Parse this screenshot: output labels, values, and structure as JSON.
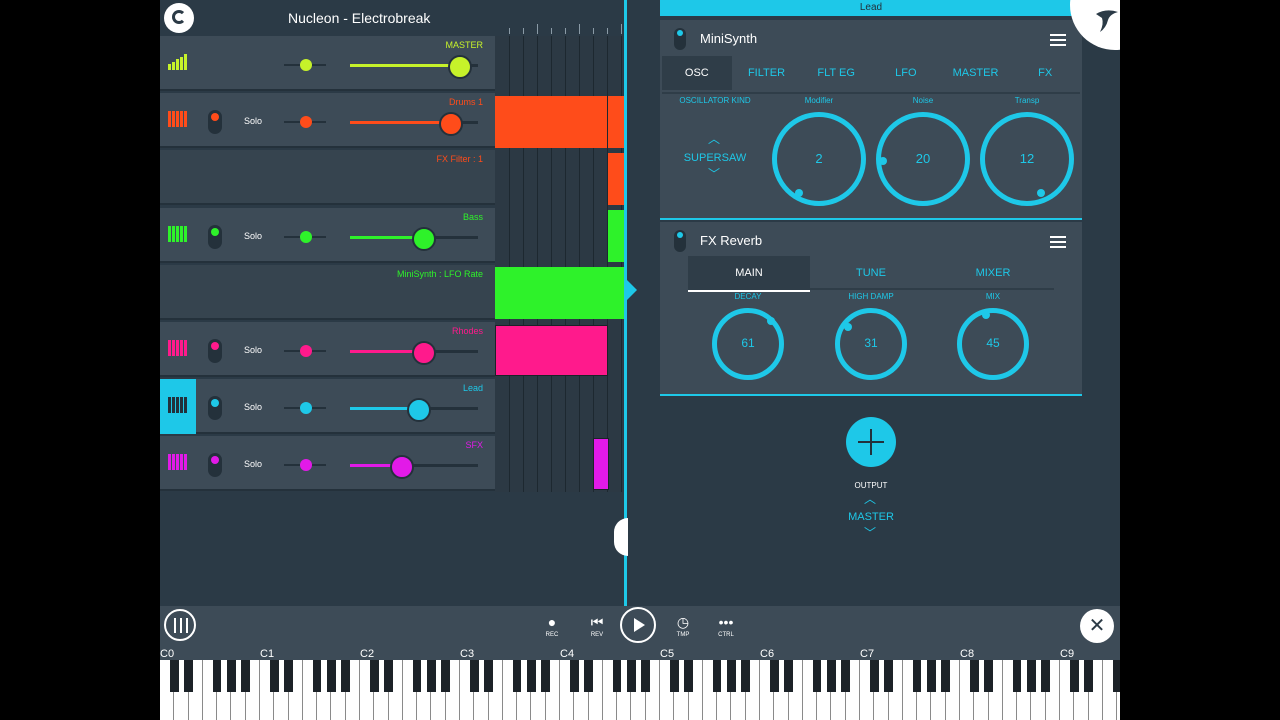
{
  "project": {
    "title": "Nucleon - Electrobreak"
  },
  "tracks": [
    {
      "name": "MASTER",
      "color": "#c6f22a",
      "icon": "level-meter-icon",
      "solo": "",
      "volume": 0.84
    },
    {
      "name": "Drums 1",
      "color": "#ff4c1a",
      "icon": "drum-pad-icon",
      "solo": "Solo",
      "volume": 0.77
    },
    {
      "name": "FX Filter : 1",
      "color": "#ff4c1a",
      "icon": "",
      "solo": "",
      "volume": null
    },
    {
      "name": "Bass",
      "color": "#2ef22a",
      "icon": "keyboard-icon",
      "solo": "Solo",
      "volume": 0.56
    },
    {
      "name": "MiniSynth : LFO Rate",
      "color": "#2ef22a",
      "icon": "",
      "solo": "",
      "volume": null
    },
    {
      "name": "Rhodes",
      "color": "#ff1a8c",
      "icon": "keyboard-icon",
      "solo": "Solo",
      "volume": 0.56
    },
    {
      "name": "Lead",
      "color": "#1ec8e8",
      "icon": "keyboard-icon",
      "solo": "Solo",
      "volume": 0.52
    },
    {
      "name": "SFX",
      "color": "#e21ae8",
      "icon": "keyboard-icon",
      "solo": "Solo",
      "volume": 0.39
    }
  ],
  "lead_bar": {
    "label": "Lead"
  },
  "minisynth": {
    "title": "MiniSynth",
    "tabs": [
      "OSC",
      "FILTER",
      "FLT EG",
      "LFO",
      "MASTER",
      "FX"
    ],
    "osc_kind_label": "OSCILLATOR KIND",
    "osc_kind_value": "SUPERSAW",
    "knobs": [
      {
        "label": "Modifier",
        "value": "2"
      },
      {
        "label": "Noise",
        "value": "20"
      },
      {
        "label": "Transp",
        "value": "12"
      }
    ]
  },
  "reverb": {
    "title": "FX Reverb",
    "tabs": [
      "MAIN",
      "TUNE",
      "MIXER"
    ],
    "knobs": [
      {
        "label": "DECAY",
        "value": "61"
      },
      {
        "label": "HIGH DAMP",
        "value": "31"
      },
      {
        "label": "MIX",
        "value": "45"
      }
    ]
  },
  "output": {
    "label": "OUTPUT",
    "value": "MASTER"
  },
  "transport": {
    "rec": "REC",
    "rev": "REV",
    "tmp": "TMP",
    "ctrl": "CTRL"
  },
  "keyboard": {
    "octaves": [
      "C0",
      "C1",
      "C2",
      "C3",
      "C4",
      "C5",
      "C6",
      "C7",
      "C8",
      "C9"
    ]
  },
  "colors": {
    "accent": "#1ec8e8",
    "panel": "#3d4b57",
    "background": "#2b3a46"
  }
}
